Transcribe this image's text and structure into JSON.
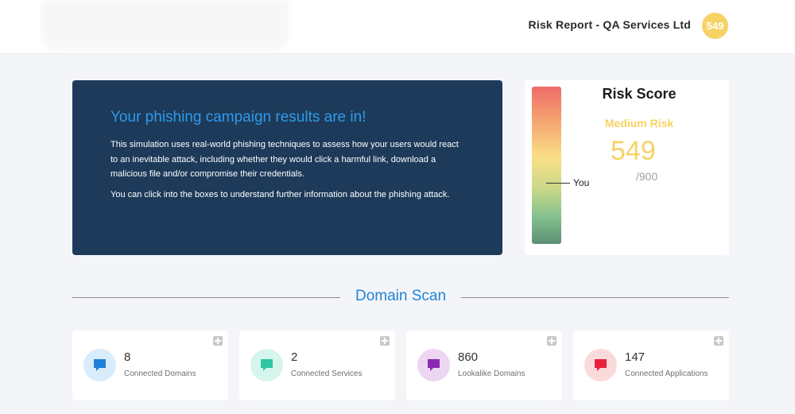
{
  "header": {
    "report_title": "Risk Report - QA Services Ltd",
    "score_badge": "549"
  },
  "hero": {
    "title": "Your phishing campaign results are in!",
    "paragraph1": "This simulation uses real-world phishing techniques to assess how your users would react to an inevitable attack, including whether they would click a harmful link, download a malicious file and/or compromise their credentials.",
    "paragraph2": "You can click into the boxes to understand further information about the phishing attack."
  },
  "risk": {
    "title": "Risk Score",
    "level": "Medium Risk",
    "value": "549",
    "max": "/900",
    "marker_label": "You",
    "gauge_fraction": 0.39
  },
  "section": {
    "title": "Domain Scan"
  },
  "stats": [
    {
      "value": "8",
      "label": "Connected Domains",
      "icon": "chat-bubble-icon",
      "color": "#1f7fd8",
      "bg": "#d9ecfb"
    },
    {
      "value": "2",
      "label": "Connected Services",
      "icon": "chat-bubble-icon",
      "color": "#2ec7a3",
      "bg": "#d6f5ec"
    },
    {
      "value": "860",
      "label": "Lookalike Domains",
      "icon": "chat-bubble-icon",
      "color": "#8a2ab0",
      "bg": "#ecd6f2"
    },
    {
      "value": "147",
      "label": "Connected Applications",
      "icon": "chat-bubble-icon",
      "color": "#e8213d",
      "bg": "#fbdada"
    }
  ],
  "colors": {
    "accent_blue": "#1f84d6",
    "hero_bg": "#1d3a5a",
    "risk_yellow": "#f7d265"
  }
}
